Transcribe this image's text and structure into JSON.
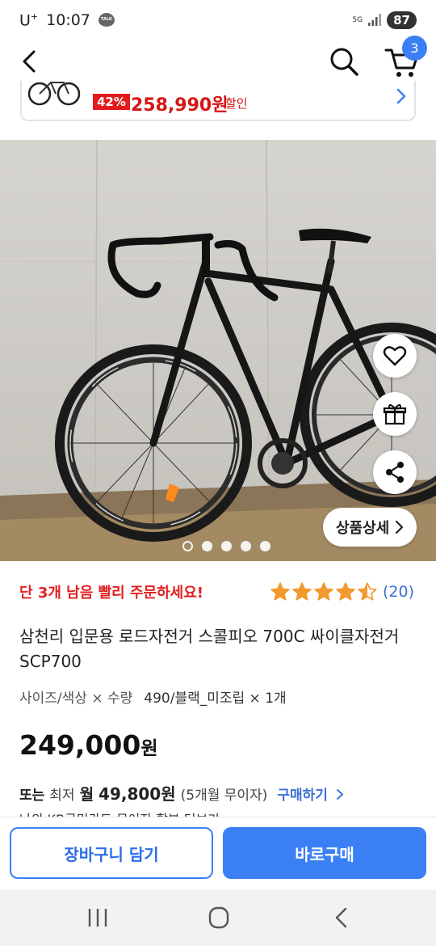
{
  "status_bar": {
    "carrier": "U",
    "carrier_sup": "+",
    "time": "10:07",
    "talk_badge": "TALK",
    "network": "5G",
    "battery": "87"
  },
  "top_nav": {
    "cart_count": "3"
  },
  "promo": {
    "discount": "42%",
    "price": "258,990원",
    "label": "할인"
  },
  "gallery": {
    "detail_button": "상품상세",
    "dots": 5,
    "active_dot": 0
  },
  "info": {
    "stock_message": "단 3개 남음 빨리 주문하세요!",
    "rating": 4.5,
    "review_count": "(20)",
    "title": "삼천리 입문용 로드자전거 스콜피오 700C 싸이클자전거 SCP700",
    "option_label": "사이즈/색상 × 수량",
    "option_value": "490/블랙_미조립 × 1개",
    "price_number": "249,000",
    "price_unit": "원",
    "installment": {
      "or": "또는",
      "min": "최저",
      "month": "월",
      "amount": "49,800원",
      "period": "(5개월 무이자)",
      "buy": "구매하기"
    },
    "card_note": "나의 KB국민카드 무이자 할부 더보기"
  },
  "actions": {
    "cart_button": "장바구니 담기",
    "buy_button": "바로구매"
  },
  "colors": {
    "accent": "#3b7ff5",
    "sale_red": "#e02020",
    "star": "#f39a2e"
  }
}
